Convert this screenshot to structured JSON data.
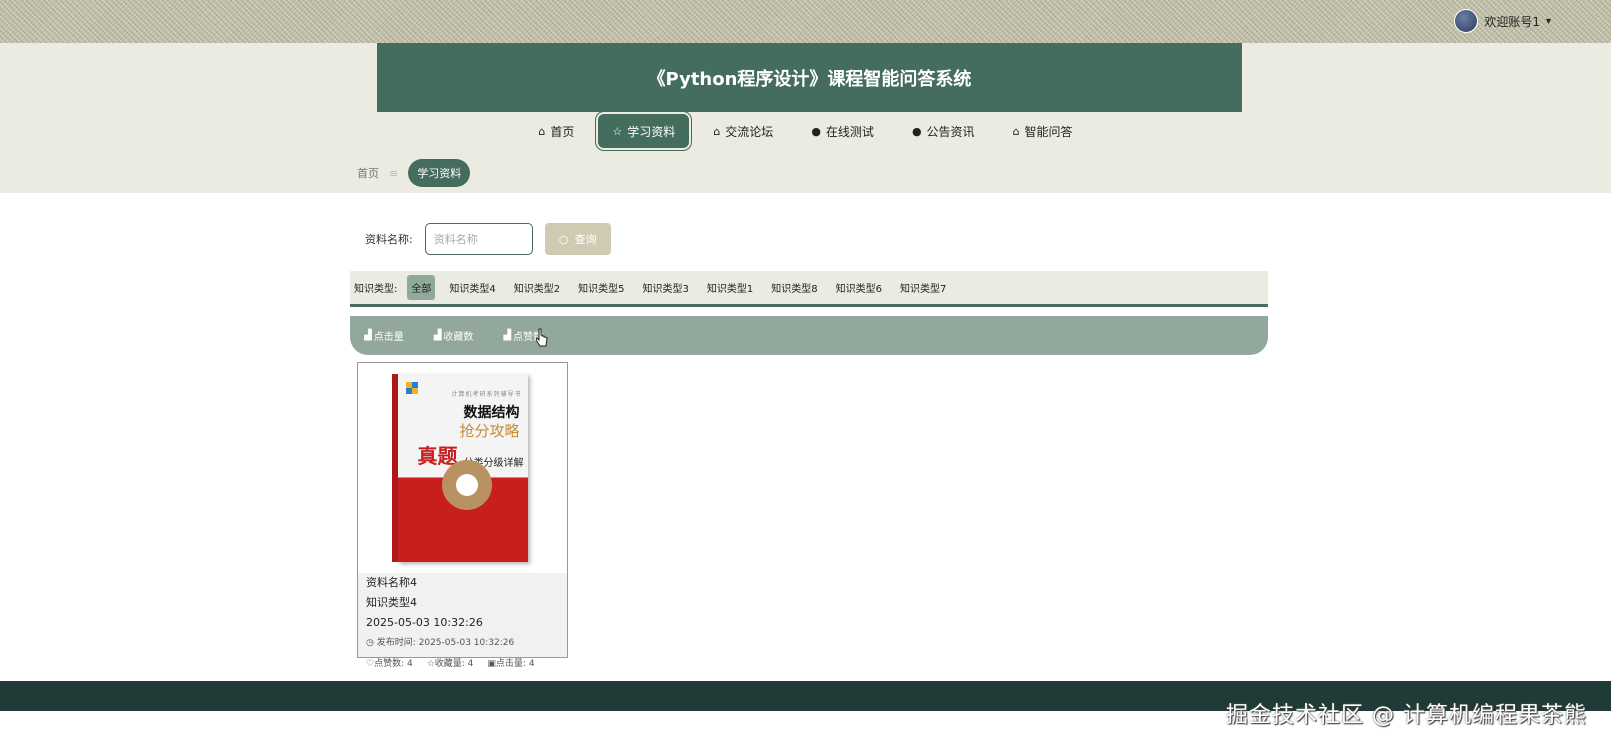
{
  "user": {
    "greeting": "欢迎账号1",
    "caret": "▾"
  },
  "site": {
    "title": "《Python程序设计》课程智能问答系统"
  },
  "nav": [
    {
      "icon": "⌂",
      "label": "首页",
      "active": false
    },
    {
      "icon": "☆",
      "label": "学习资料",
      "active": true
    },
    {
      "icon": "⌂",
      "label": "交流论坛",
      "active": false
    },
    {
      "icon": "●",
      "label": "在线测试",
      "active": false
    },
    {
      "icon": "●",
      "label": "公告资讯",
      "active": false
    },
    {
      "icon": "⌂",
      "label": "智能问答",
      "active": false
    }
  ],
  "breadcrumb": {
    "home": "首页",
    "sep": "≡",
    "current": "学习资料"
  },
  "search": {
    "label": "资料名称:",
    "placeholder": "资料名称",
    "button": "查询"
  },
  "types": {
    "label": "知识类型:",
    "options": [
      "全部",
      "知识类型4",
      "知识类型2",
      "知识类型5",
      "知识类型3",
      "知识类型1",
      "知识类型8",
      "知识类型6",
      "知识类型7"
    ]
  },
  "sort": [
    "点击量",
    "收藏数",
    "点赞数"
  ],
  "card": {
    "name": "资料名称4",
    "type": "知识类型4",
    "datetime": "2025-05-03 10:32:26",
    "publish": "发布时间: 2025-05-03 10:32:26",
    "likes": "点赞数: 4",
    "favorites": "收藏量: 4",
    "clicks": "点击量: 4",
    "book": {
      "top": "计算机考研系列辅导书",
      "t1": "数据结构",
      "t2": "抢分攻略",
      "t3": "真题",
      "t4": "分类分级详解"
    }
  },
  "watermark": "掘金技术社区 @ 计算机编程果茶熊"
}
